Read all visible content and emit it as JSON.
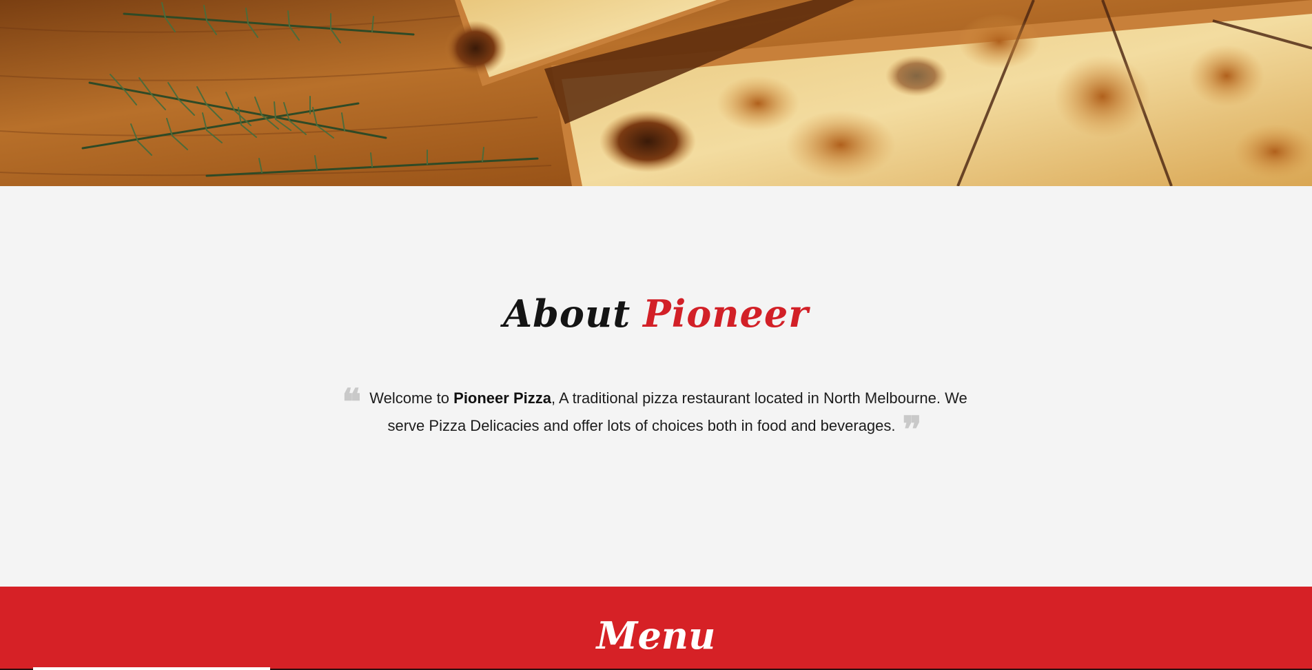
{
  "hero": {
    "image": "pizza-with-rosemary-on-wooden-board"
  },
  "about": {
    "title_part1": "About",
    "title_part2": "Pioneer",
    "open_quote": "❝",
    "close_quote": "❞",
    "text_before": "Welcome to ",
    "text_bold": "Pioneer Pizza",
    "text_after": ", A traditional pizza restaurant located in North Melbourne. We serve Pizza Delicacies and offer lots of choices both in food and beverages."
  },
  "menu": {
    "title": "Menu"
  },
  "colors": {
    "accent_red": "#d62126",
    "title_red": "#d22027",
    "background": "#f4f4f4",
    "quote_gray": "#c9c9c9"
  }
}
